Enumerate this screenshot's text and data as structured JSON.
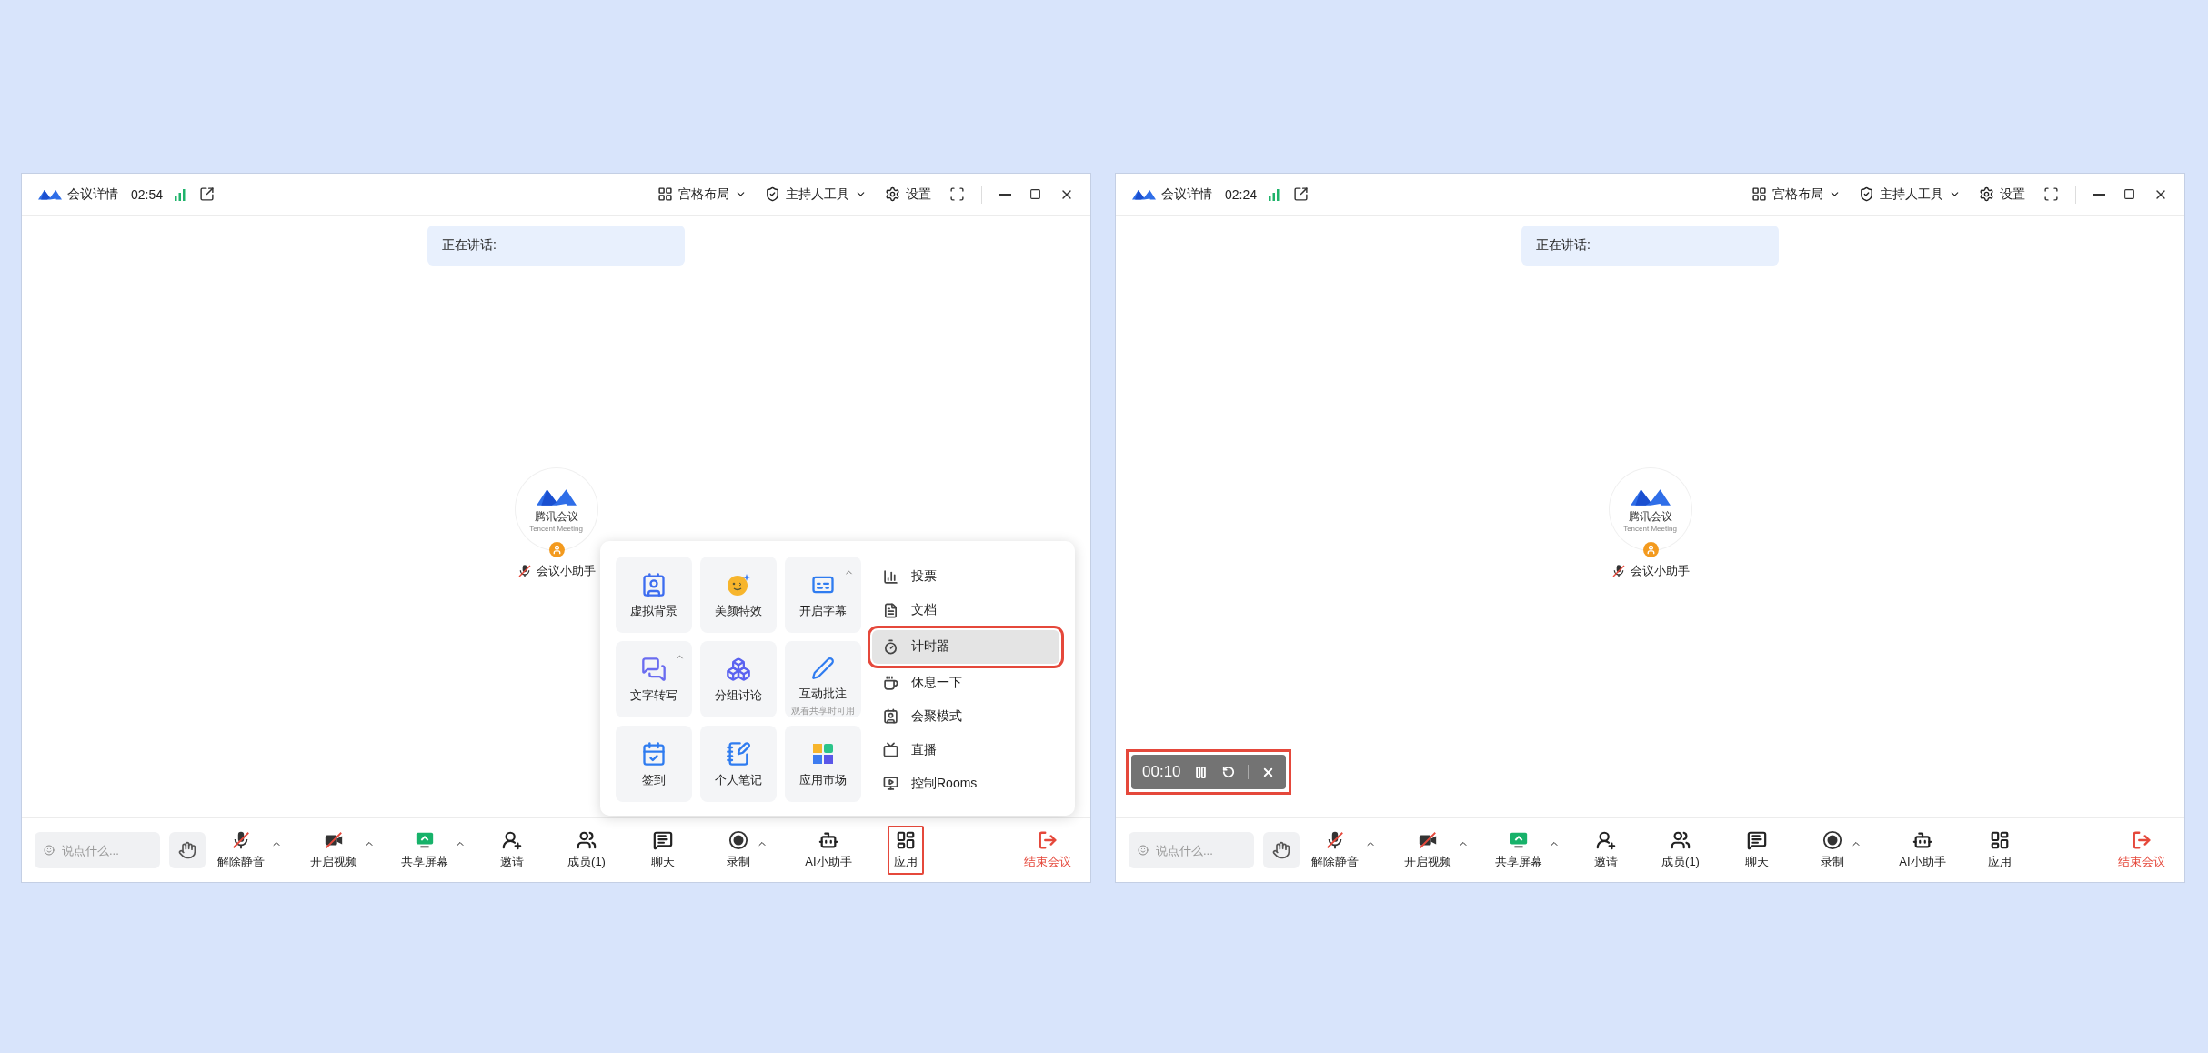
{
  "windows": [
    {
      "details_label": "会议详情",
      "duration": "02:54",
      "top_actions": [
        {
          "kind": "layout",
          "label": "宫格布局",
          "caret": true
        },
        {
          "kind": "host",
          "label": "主持人工具",
          "caret": true
        },
        {
          "kind": "settings",
          "label": "设置",
          "caret": false
        }
      ],
      "speaking_label": "正在讲话:",
      "participant": {
        "logo_text": "腾讯会议",
        "logo_subtext": "Tencent Meeting",
        "name": "会议小助手",
        "muted": true
      },
      "chat_placeholder": "说点什么...",
      "controls": [
        {
          "kind": "mic",
          "label": "解除静音",
          "caret": true,
          "highlighted": false
        },
        {
          "kind": "video",
          "label": "开启视频",
          "caret": true,
          "highlighted": false
        },
        {
          "kind": "share",
          "label": "共享屏幕",
          "caret": true,
          "highlighted": false
        },
        {
          "kind": "invite",
          "label": "邀请",
          "caret": false,
          "highlighted": false
        },
        {
          "kind": "members",
          "label": "成员(1)",
          "caret": false,
          "highlighted": false
        },
        {
          "kind": "chat",
          "label": "聊天",
          "caret": false,
          "highlighted": false
        },
        {
          "kind": "record",
          "label": "录制",
          "caret": true,
          "highlighted": false
        },
        {
          "kind": "ai",
          "label": "AI小助手",
          "caret": false,
          "highlighted": false
        },
        {
          "kind": "apps",
          "label": "应用",
          "caret": false,
          "highlighted": true
        }
      ],
      "end_label": "结束会议",
      "apps_panel": {
        "tiles": [
          {
            "kind": "virtual-bg",
            "label": "虚拟背景",
            "caret": false
          },
          {
            "kind": "beauty",
            "label": "美颜特效",
            "caret": false
          },
          {
            "kind": "captions",
            "label": "开启字幕",
            "caret": true
          },
          {
            "kind": "transcribe",
            "label": "文字转写",
            "caret": true
          },
          {
            "kind": "breakout",
            "label": "分组讨论",
            "caret": false
          },
          {
            "kind": "annotate",
            "label": "互动批注",
            "note": "观看共享时可用",
            "caret": false
          },
          {
            "kind": "checkin",
            "label": "签到",
            "caret": false
          },
          {
            "kind": "notes",
            "label": "个人笔记",
            "caret": false
          },
          {
            "kind": "market",
            "label": "应用市场",
            "caret": false
          }
        ],
        "items": [
          {
            "kind": "poll",
            "label": "投票",
            "highlighted": false
          },
          {
            "kind": "doc",
            "label": "文档",
            "highlighted": false
          },
          {
            "kind": "timer",
            "label": "计时器",
            "highlighted": true
          },
          {
            "kind": "break",
            "label": "休息一下",
            "highlighted": false
          },
          {
            "kind": "together",
            "label": "会聚模式",
            "highlighted": false
          },
          {
            "kind": "live",
            "label": "直播",
            "highlighted": false
          },
          {
            "kind": "rooms",
            "label": "控制Rooms",
            "highlighted": false
          }
        ]
      }
    },
    {
      "details_label": "会议详情",
      "duration": "02:24",
      "top_actions": [
        {
          "kind": "layout",
          "label": "宫格布局",
          "caret": true
        },
        {
          "kind": "host",
          "label": "主持人工具",
          "caret": true
        },
        {
          "kind": "settings",
          "label": "设置",
          "caret": false
        }
      ],
      "speaking_label": "正在讲话:",
      "participant": {
        "logo_text": "腾讯会议",
        "logo_subtext": "Tencent Meeting",
        "name": "会议小助手",
        "muted": true
      },
      "chat_placeholder": "说点什么...",
      "controls": [
        {
          "kind": "mic",
          "label": "解除静音",
          "caret": true,
          "highlighted": false
        },
        {
          "kind": "video",
          "label": "开启视频",
          "caret": true,
          "highlighted": false
        },
        {
          "kind": "share",
          "label": "共享屏幕",
          "caret": true,
          "highlighted": false
        },
        {
          "kind": "invite",
          "label": "邀请",
          "caret": false,
          "highlighted": false
        },
        {
          "kind": "members",
          "label": "成员(1)",
          "caret": false,
          "highlighted": false
        },
        {
          "kind": "chat",
          "label": "聊天",
          "caret": false,
          "highlighted": false
        },
        {
          "kind": "record",
          "label": "录制",
          "caret": true,
          "highlighted": false
        },
        {
          "kind": "ai",
          "label": "AI小助手",
          "caret": false,
          "highlighted": false
        },
        {
          "kind": "apps",
          "label": "应用",
          "caret": false,
          "highlighted": false
        }
      ],
      "end_label": "结束会议",
      "timer": {
        "time": "00:10",
        "highlighted": true
      }
    }
  ]
}
